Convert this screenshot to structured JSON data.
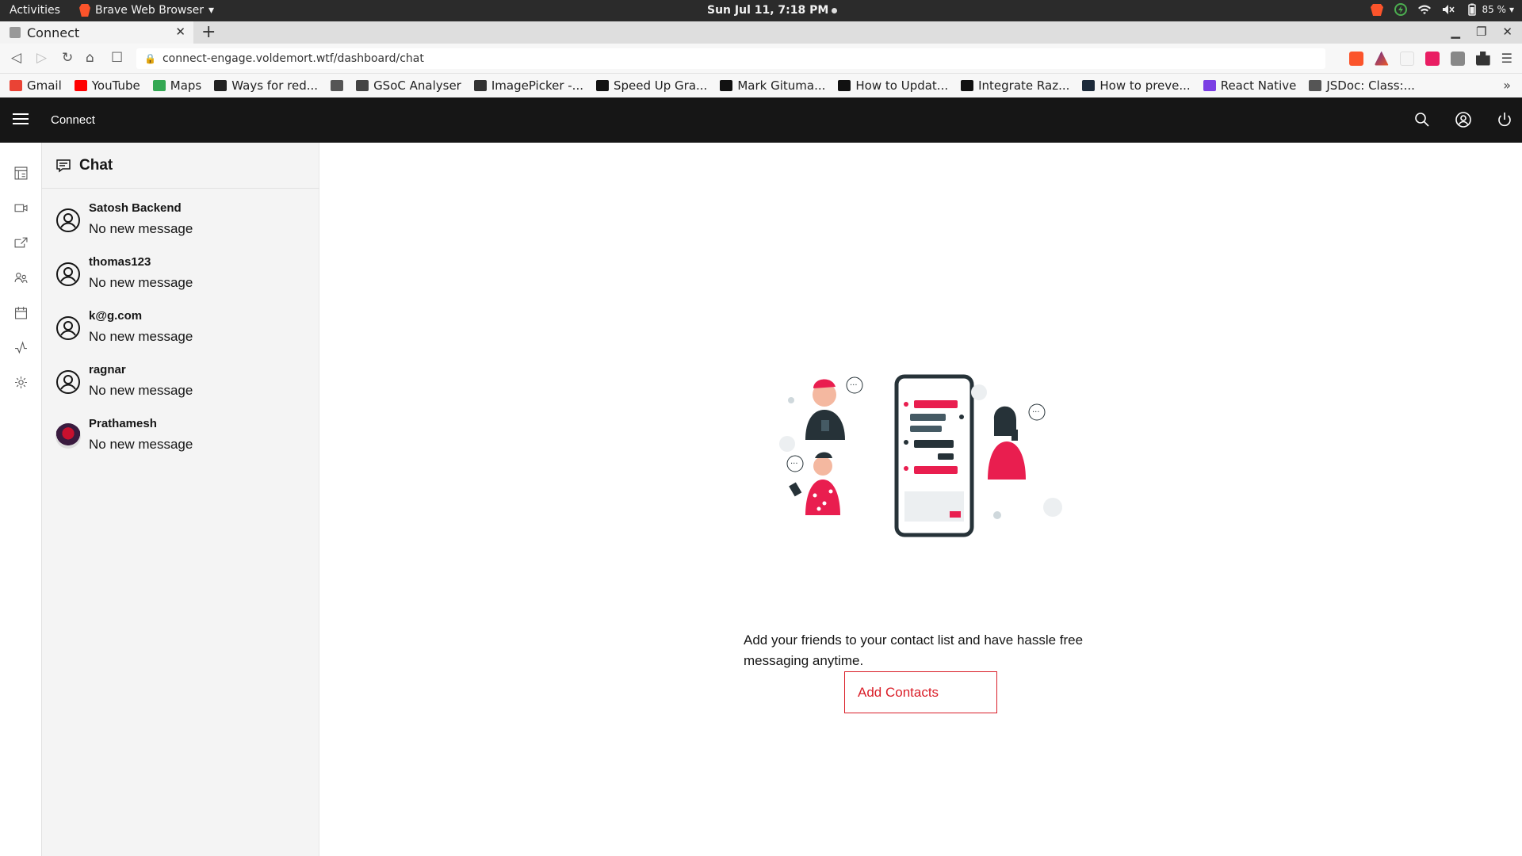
{
  "system_bar": {
    "activities": "Activities",
    "app_name": "Brave Web Browser",
    "clock": "Sun Jul 11,  7:18 PM",
    "battery": "85 %"
  },
  "browser": {
    "tab_title": "Connect",
    "url": "connect-engage.voldemort.wtf/dashboard/chat",
    "bookmarks": [
      {
        "label": "Gmail",
        "icon": "gmail-icon",
        "color": "#ea4335"
      },
      {
        "label": "YouTube",
        "icon": "youtube-icon",
        "color": "#ff0000"
      },
      {
        "label": "Maps",
        "icon": "maps-icon",
        "color": "#34a853"
      },
      {
        "label": "Ways for red...",
        "icon": "site-icon",
        "color": "#222222"
      },
      {
        "label": "",
        "icon": "globe-icon",
        "color": "#555555"
      },
      {
        "label": "GSoC Analyser",
        "icon": "chart-icon",
        "color": "#444444"
      },
      {
        "label": "ImagePicker -...",
        "icon": "github-icon",
        "color": "#333333"
      },
      {
        "label": "Speed Up Gra...",
        "icon": "medium-icon",
        "color": "#111111"
      },
      {
        "label": "Mark Gituma...",
        "icon": "medium-icon",
        "color": "#111111"
      },
      {
        "label": "How to Updat...",
        "icon": "dev-icon",
        "color": "#111111"
      },
      {
        "label": "Integrate Raz...",
        "icon": "dev-icon",
        "color": "#111111"
      },
      {
        "label": "How to preve...",
        "icon": "site-icon",
        "color": "#1c2a3a"
      },
      {
        "label": "React Native",
        "icon": "dots-icon",
        "color": "#7b3fe4"
      },
      {
        "label": "JSDoc: Class:...",
        "icon": "globe-icon",
        "color": "#555555"
      }
    ]
  },
  "app": {
    "title": "Connect",
    "accent": "#da1e28",
    "header_bg": "#161616"
  },
  "chat": {
    "title": "Chat",
    "contacts": [
      {
        "name": "Satosh Backend",
        "message": "No new message",
        "avatar": "user-icon"
      },
      {
        "name": "thomas123",
        "message": "No new message",
        "avatar": "user-icon"
      },
      {
        "name": "k@g.com",
        "message": "No new message",
        "avatar": "user-icon"
      },
      {
        "name": "ragnar",
        "message": "No new message",
        "avatar": "user-icon"
      },
      {
        "name": "Prathamesh",
        "message": "No new message",
        "avatar": "photo"
      }
    ]
  },
  "empty_state": {
    "text": "Add your friends to your contact list and have hassle free messaging anytime.",
    "button": "Add Contacts"
  }
}
